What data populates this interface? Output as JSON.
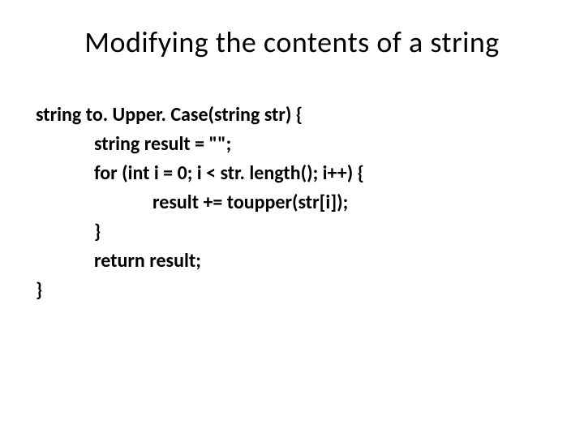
{
  "title": "Modifying the contents of a string",
  "code": {
    "line1": "string to. Upper. Case(string str) {",
    "line2": "string result = \"\";",
    "line3": "for (int i = 0; i < str. length(); i++) {",
    "line4": "result += toupper(str[i]);",
    "line5": "}",
    "line6": "return result;",
    "line7": "}"
  }
}
